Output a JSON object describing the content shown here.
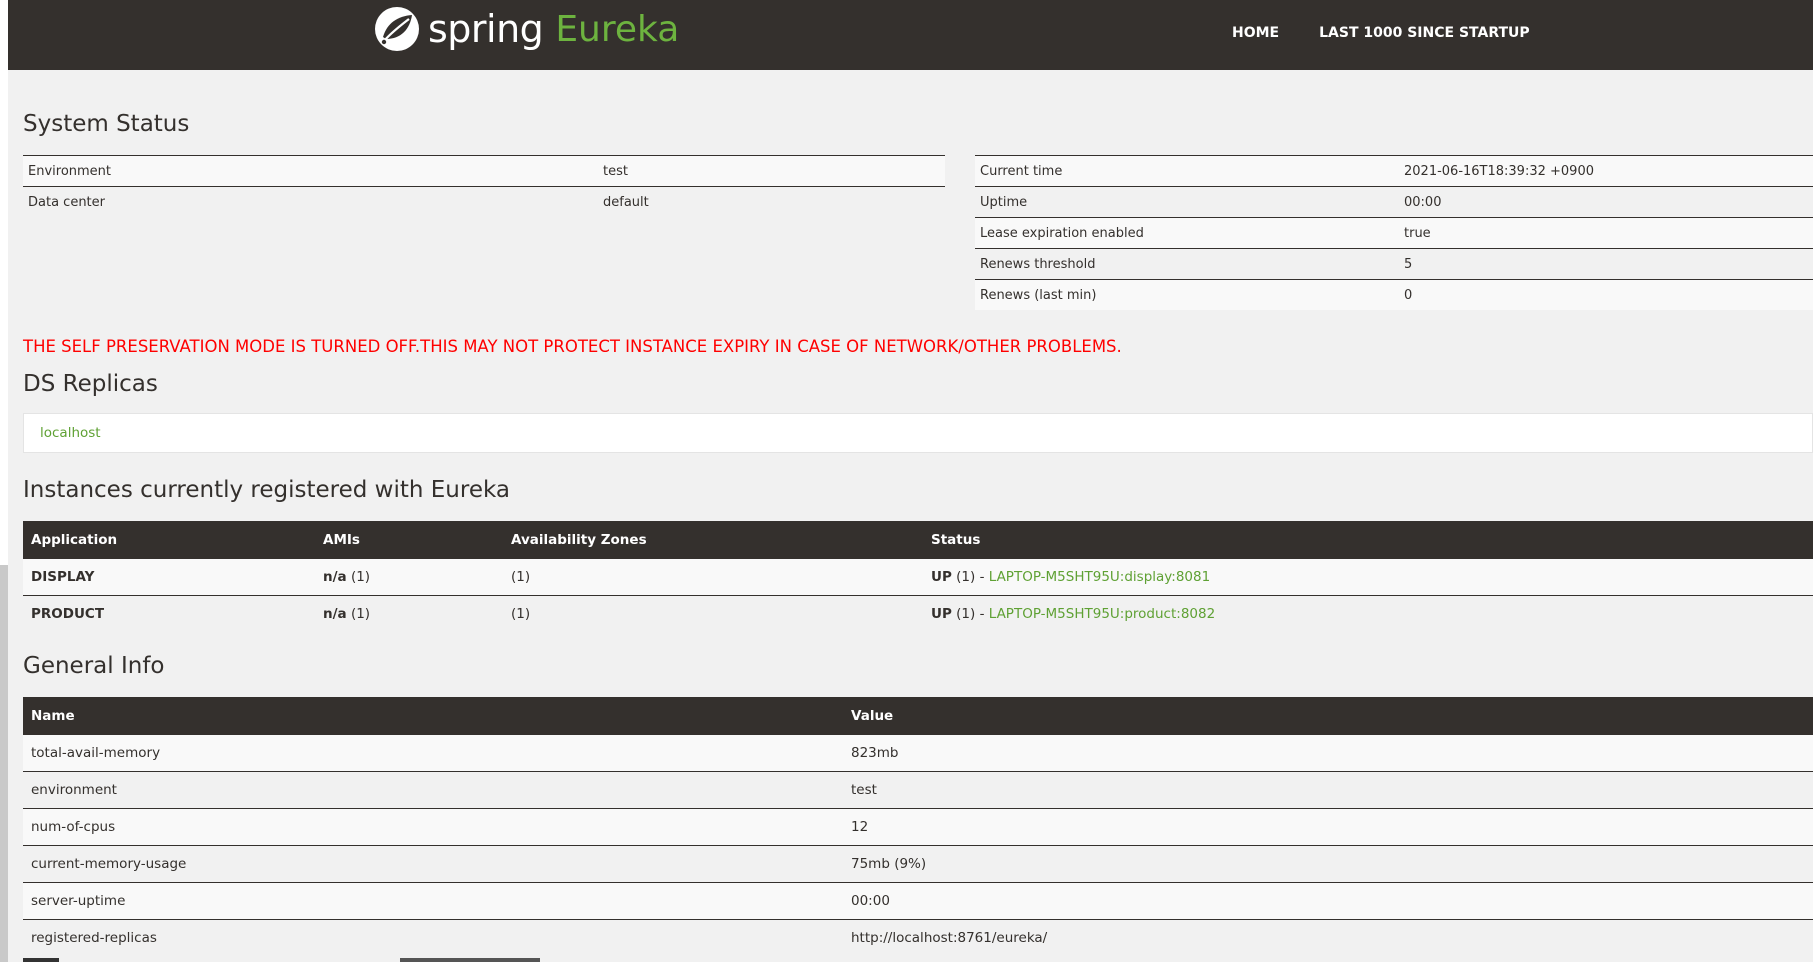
{
  "header": {
    "brand_spring": "spring",
    "brand_eureka": "Eureka",
    "nav": [
      {
        "label": "HOME"
      },
      {
        "label": "LAST 1000 SINCE STARTUP"
      }
    ]
  },
  "system_status": {
    "title": "System Status",
    "left": [
      {
        "label": "Environment",
        "value": "test"
      },
      {
        "label": "Data center",
        "value": "default"
      }
    ],
    "right": [
      {
        "label": "Current time",
        "value": "2021-06-16T18:39:32 +0900"
      },
      {
        "label": "Uptime",
        "value": "00:00"
      },
      {
        "label": "Lease expiration enabled",
        "value": "true"
      },
      {
        "label": "Renews threshold",
        "value": "5"
      },
      {
        "label": "Renews (last min)",
        "value": "0"
      }
    ]
  },
  "warning": "THE SELF PRESERVATION MODE IS TURNED OFF.THIS MAY NOT PROTECT INSTANCE EXPIRY IN CASE OF NETWORK/OTHER PROBLEMS.",
  "ds_replicas": {
    "title": "DS Replicas",
    "items": [
      "localhost"
    ]
  },
  "instances": {
    "title": "Instances currently registered with Eureka",
    "headers": [
      "Application",
      "AMIs",
      "Availability Zones",
      "Status"
    ],
    "rows": [
      {
        "application": "DISPLAY",
        "ami_label": "n/a",
        "ami_count": "(1)",
        "zones": "(1)",
        "status": "UP",
        "status_count": "(1) - ",
        "instance": "LAPTOP-M5SHT95U:display:8081"
      },
      {
        "application": "PRODUCT",
        "ami_label": "n/a",
        "ami_count": "(1)",
        "zones": "(1)",
        "status": "UP",
        "status_count": "(1) - ",
        "instance": "LAPTOP-M5SHT95U:product:8082"
      }
    ]
  },
  "general_info": {
    "title": "General Info",
    "headers": [
      "Name",
      "Value"
    ],
    "rows": [
      {
        "name": "total-avail-memory",
        "value": "823mb"
      },
      {
        "name": "environment",
        "value": "test"
      },
      {
        "name": "num-of-cpus",
        "value": "12"
      },
      {
        "name": "current-memory-usage",
        "value": "75mb (9%)"
      },
      {
        "name": "server-uptime",
        "value": "00:00"
      },
      {
        "name": "registered-replicas",
        "value": "http://localhost:8761/eureka/"
      }
    ]
  },
  "colors": {
    "header_bg": "#34302d",
    "brand_green": "#6db33f",
    "link_green": "#5fa134",
    "warning_red": "#ff0000",
    "page_bg": "#f1f1f1"
  }
}
